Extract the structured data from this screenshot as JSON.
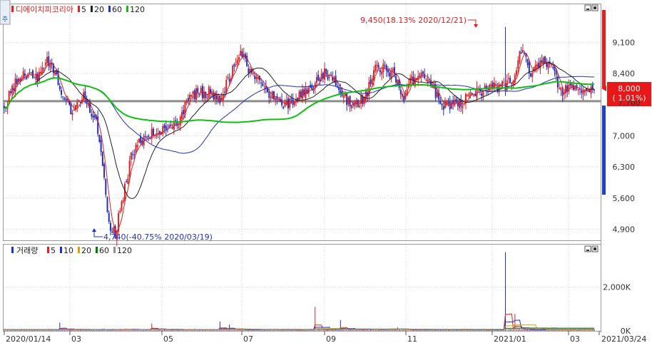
{
  "chart_data": {
    "type": "candlestick",
    "stock_name": "디에이치피코리아",
    "price_panel": {
      "ma_legend": [
        {
          "label": "5",
          "color": "#e02020"
        },
        {
          "label": "20",
          "color": "#222222"
        },
        {
          "label": "60",
          "color": "#2030c0"
        },
        {
          "label": "120",
          "color": "#10c010"
        }
      ],
      "y_ticks": [
        "9,100",
        "8,400",
        "7,000",
        "6,300",
        "5,600",
        "4,900"
      ],
      "y_tick_values": [
        9100,
        8400,
        7000,
        6300,
        5600,
        4900
      ],
      "ylim": [
        4650,
        9960
      ],
      "high_annotation": "9,450(18.13% 2020/12/21)",
      "low_annotation": "4,740(-40.75% 2020/03/19)",
      "current_price": "8,000",
      "current_change": "( 1.01%)",
      "partial_tick": "7,700",
      "reference_price": 7780
    },
    "volume_panel": {
      "title": "거래량",
      "ma_legend": [
        {
          "label": "5",
          "color": "#e02020"
        },
        {
          "label": "10",
          "color": "#2030c0"
        },
        {
          "label": "20",
          "color": "#e0a000"
        },
        {
          "label": "60",
          "color": "#008000"
        },
        {
          "label": "120",
          "color": "#909090"
        }
      ],
      "y_ticks": [
        "2,000K",
        "0K"
      ],
      "y_tick_values": [
        2000,
        0
      ],
      "ylim": [
        0,
        3950
      ],
      "unit": "K"
    },
    "x_labels": [
      "2020/01/14",
      "03",
      "05",
      "07",
      "09",
      "11",
      "2021/01",
      "03",
      "2021/03/24"
    ],
    "price_anchors": [
      [
        0,
        7600
      ],
      [
        5,
        8100
      ],
      [
        12,
        8400
      ],
      [
        20,
        8300
      ],
      [
        28,
        8700
      ],
      [
        36,
        8000
      ],
      [
        42,
        7600
      ],
      [
        50,
        7950
      ],
      [
        58,
        7300
      ],
      [
        62,
        6400
      ],
      [
        66,
        5000
      ],
      [
        70,
        4800
      ],
      [
        74,
        5500
      ],
      [
        80,
        6500
      ],
      [
        88,
        7000
      ],
      [
        96,
        7100
      ],
      [
        104,
        7200
      ],
      [
        110,
        7300
      ],
      [
        116,
        7900
      ],
      [
        122,
        7950
      ],
      [
        130,
        8000
      ],
      [
        136,
        7800
      ],
      [
        144,
        8500
      ],
      [
        150,
        8900
      ],
      [
        156,
        8300
      ],
      [
        164,
        8100
      ],
      [
        172,
        7750
      ],
      [
        178,
        7700
      ],
      [
        186,
        7900
      ],
      [
        194,
        8100
      ],
      [
        202,
        8400
      ],
      [
        208,
        8300
      ],
      [
        216,
        7800
      ],
      [
        222,
        7700
      ],
      [
        228,
        7900
      ],
      [
        234,
        8600
      ],
      [
        240,
        8500
      ],
      [
        246,
        8400
      ],
      [
        252,
        7700
      ],
      [
        256,
        8200
      ],
      [
        264,
        8400
      ],
      [
        270,
        8100
      ],
      [
        276,
        7700
      ],
      [
        282,
        7650
      ],
      [
        290,
        7800
      ],
      [
        298,
        8000
      ],
      [
        306,
        8050
      ],
      [
        312,
        8100
      ],
      [
        320,
        8200
      ],
      [
        326,
        8900
      ],
      [
        332,
        8400
      ],
      [
        338,
        8700
      ],
      [
        346,
        8500
      ],
      [
        350,
        8000
      ],
      [
        356,
        8100
      ],
      [
        364,
        7950
      ],
      [
        370,
        8050
      ],
      [
        372,
        8000
      ]
    ],
    "volume_spikes": [
      {
        "bar": 35,
        "value": 380
      },
      {
        "bar": 93,
        "value": 340
      },
      {
        "bar": 136,
        "value": 430
      },
      {
        "bar": 142,
        "value": 290
      },
      {
        "bar": 196,
        "value": 1100
      },
      {
        "bar": 212,
        "value": 500
      },
      {
        "bar": 248,
        "value": 170
      },
      {
        "bar": 316,
        "value": 3600
      },
      {
        "bar": 322,
        "value": 780
      }
    ]
  }
}
